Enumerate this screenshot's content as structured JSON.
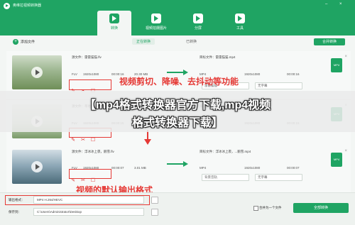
{
  "app": {
    "title": "奥维拉视频转换器",
    "min": "–",
    "close": "×"
  },
  "nav": [
    {
      "label": "转换",
      "icon": "convert-icon"
    },
    {
      "label": "视频拍摄图片",
      "icon": "screenshot-icon"
    },
    {
      "label": "分屏",
      "icon": "split-icon"
    },
    {
      "label": "工具",
      "icon": "toolbox-icon"
    }
  ],
  "toolbar": {
    "add_file": "添加文件",
    "tab_converting": "正在转换",
    "tab_done": "已转换",
    "merge_button": "合并转换"
  },
  "rows": [
    {
      "src_label": "源文件：",
      "src_name": "雷雷猫猫.flv",
      "src_format": "FLV",
      "src_res": "1920x1080",
      "src_time": "00:00:16",
      "src_size": "20.30 MB",
      "dst_label": "目标文件：",
      "dst_name": "雷雷猫猫.mp4",
      "dst_format": "MP4",
      "dst_res": "1920x1080",
      "dst_time": "00:00:16",
      "audio": "雷雷猫猫",
      "subtitle": "无字幕",
      "format_badge": "MP4"
    },
    {
      "src_label": "源文件：",
      "src_name": "草地.flv",
      "src_format": "FLV",
      "src_res": "1920x1080",
      "src_time": "00:00:15",
      "src_size": "",
      "dst_label": "目标文件：",
      "dst_name": "草地.mp4",
      "dst_format": "MP4",
      "dst_res": "1920x1080",
      "dst_time": "00:00:15",
      "audio": "",
      "subtitle": "",
      "format_badge": "MP4"
    },
    {
      "src_label": "源文件：",
      "src_name": "浮冰冰上裹，鹅雪.flv",
      "src_format": "FLV",
      "src_res": "1920x1080",
      "src_time": "00:00:07",
      "src_size": "3.01 MB",
      "dst_label": "目标文件：",
      "dst_name": "浮冰冰上裹，...鹅雪.mp4",
      "dst_format": "MP4",
      "dst_res": "1920x1080",
      "dst_time": "00:00:07",
      "audio": "背景音轨",
      "subtitle": "无字幕",
      "format_badge": "MP4"
    }
  ],
  "annotations": {
    "edit": "视频剪切、降噪、去抖动等功能",
    "output": "视频的默认输出格式",
    "banner_line1": "【mp4格式转换器官方下载,mp4视频",
    "banner_line2": "格式转换器下载】"
  },
  "bottom": {
    "output_label": "输出格式：",
    "output_value": "MP4 H.264/HEVC",
    "save_label": "保存到：",
    "save_path": "C:\\Users\\Administrator\\Desktop",
    "merge_checkbox": "合并为一个文件",
    "convert_button": "全部转换"
  }
}
